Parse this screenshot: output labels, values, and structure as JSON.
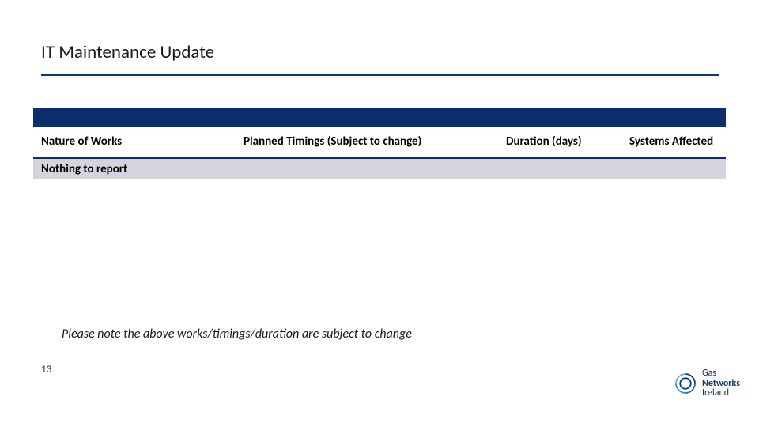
{
  "title": "IT Maintenance Update",
  "table": {
    "headers": {
      "nature": "Nature of Works",
      "timing": "Planned Timings (Subject to change)",
      "duration": "Duration (days)",
      "systems": "Systems Affected"
    },
    "rows": [
      {
        "nature": "Nothing to report",
        "timing": "",
        "duration": "",
        "systems": ""
      }
    ]
  },
  "note": "Please note the above works/timings/duration are subject to change",
  "page_number": "13",
  "logo": {
    "line1": "Gas",
    "line2": "Networks",
    "line3": "Ireland"
  },
  "colors": {
    "brand_blue": "#0b3a6f",
    "row_odd": "#d5d3dc"
  }
}
